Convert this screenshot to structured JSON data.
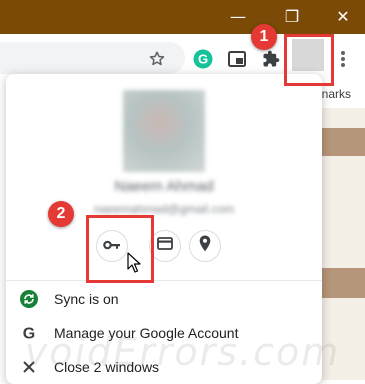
{
  "window_controls": {
    "minimize_glyph": "—",
    "restore_glyph": "❐",
    "close_glyph": "✕"
  },
  "bookmarks_bar": {
    "visible_text": "narks"
  },
  "profile_menu": {
    "name": "Naeem Ahmad",
    "email": "naeemahmad@gmail.com",
    "shortcuts": [
      {
        "icon": "key-icon",
        "name": "passwords"
      },
      {
        "icon": "credit-card-icon",
        "name": "payment-methods"
      },
      {
        "icon": "location-pin-icon",
        "name": "addresses"
      }
    ],
    "items": [
      {
        "icon": "sync-icon",
        "label": "Sync is on"
      },
      {
        "icon": "google-g-icon",
        "label": "Manage your Google Account"
      },
      {
        "icon": "close-icon",
        "label": "Close 2 windows"
      }
    ]
  },
  "annotations": [
    {
      "number": "1"
    },
    {
      "number": "2"
    }
  ],
  "colors": {
    "titlebar": "#7a4a06",
    "annotation_red": "#e53935",
    "sync_green": "#188038",
    "grammarly_green": "#15c39a"
  },
  "watermark": "voidErrors.com"
}
